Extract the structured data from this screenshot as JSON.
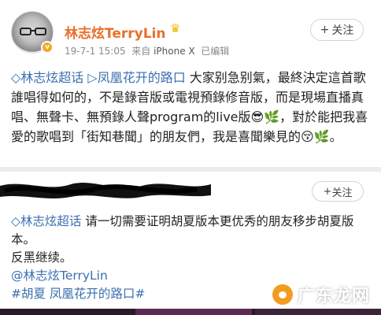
{
  "post1": {
    "username": "林志炫TerryLin",
    "crown_icon": "crown-icon",
    "verified_badge": "v",
    "date": "19-7-1 15:05",
    "source_prefix": "来自",
    "source_device": "iPhone X",
    "edited": "已编辑",
    "follow_label": "关注",
    "text": {
      "topic_link": "◇林志炫超话",
      "topic_link2": "▷凤凰花开的路口",
      "body_a": " 大家别急别氣，最終決定這首歌誰唱得如何的，不是錄音版或電視預錄修音版，而是現場直播真唱、無聲卡、無預錄人聲program的live版",
      "emoji_a": "😎🌿",
      "body_b": "，對於能把我喜愛的歌唱到「街知巷聞」的朋友們，我是喜聞樂見的",
      "emoji_b": "😚🌿",
      "body_c": "。"
    }
  },
  "post2": {
    "follow_label": "关注",
    "line1_link": "◇林志炫超话",
    "line1_text": " 请一切需要证明胡夏版本更优秀的朋友移步胡夏版本。",
    "line2": "反黑继续。",
    "mention": "@林志炫TerryLin",
    "hashtag": "#胡夏 凤凰花开的路口#"
  },
  "watermark": "广东龙网",
  "colors": {
    "username": "#e8702a",
    "link": "#3a6fb0",
    "meta": "#8a8a8a",
    "divider": "#ececec"
  }
}
